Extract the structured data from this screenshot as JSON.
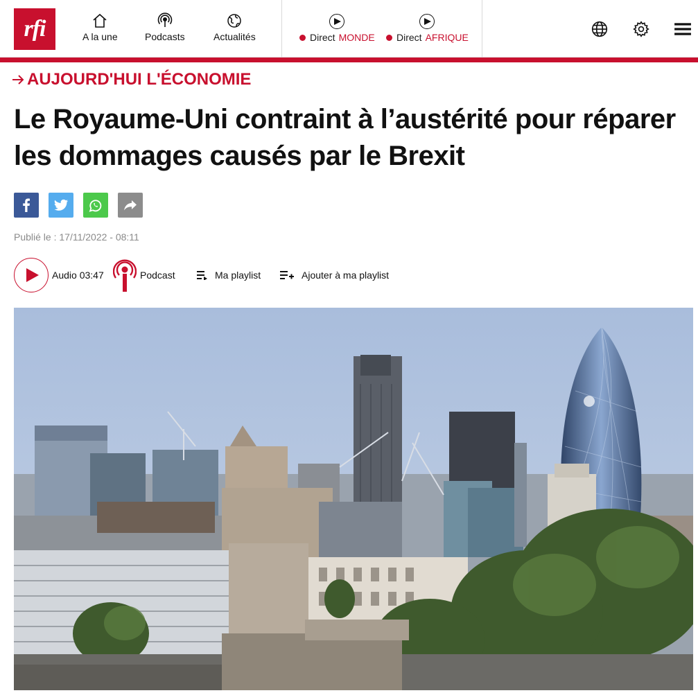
{
  "header": {
    "logo_text": "rfi",
    "nav": [
      {
        "label": "A la une",
        "icon": "home-icon"
      },
      {
        "label": "Podcasts",
        "icon": "podcast-icon"
      },
      {
        "label": "Actualités",
        "icon": "globe-icon"
      }
    ],
    "live": [
      {
        "prefix": "Direct",
        "accent": "MONDE"
      },
      {
        "prefix": "Direct",
        "accent": "AFRIQUE"
      }
    ],
    "right_icons": [
      "language-globe-icon",
      "settings-gear-icon",
      "menu-hamburger-icon"
    ]
  },
  "article": {
    "kicker": "AUJOURD'HUI L'ÉCONOMIE",
    "title": "Le Royaume-Uni contraint à l’austérité pour répa­rer les dommages causés par le Brexit",
    "share": [
      "facebook-icon",
      "twitter-icon",
      "whatsapp-icon",
      "share-icon"
    ],
    "published": "Publié le : 17/11/2022 - 08:11",
    "audio": {
      "audio_label": "Audio 03:47",
      "podcast_label": "Podcast",
      "playlist_label": "Ma playlist",
      "add_playlist_label": "Ajouter à ma playlist"
    }
  },
  "colors": {
    "brand_red": "#c8102e",
    "facebook": "#3b5998",
    "twitter": "#55acee",
    "whatsapp": "#4cc94b",
    "share_grey": "#8c8c8c"
  }
}
